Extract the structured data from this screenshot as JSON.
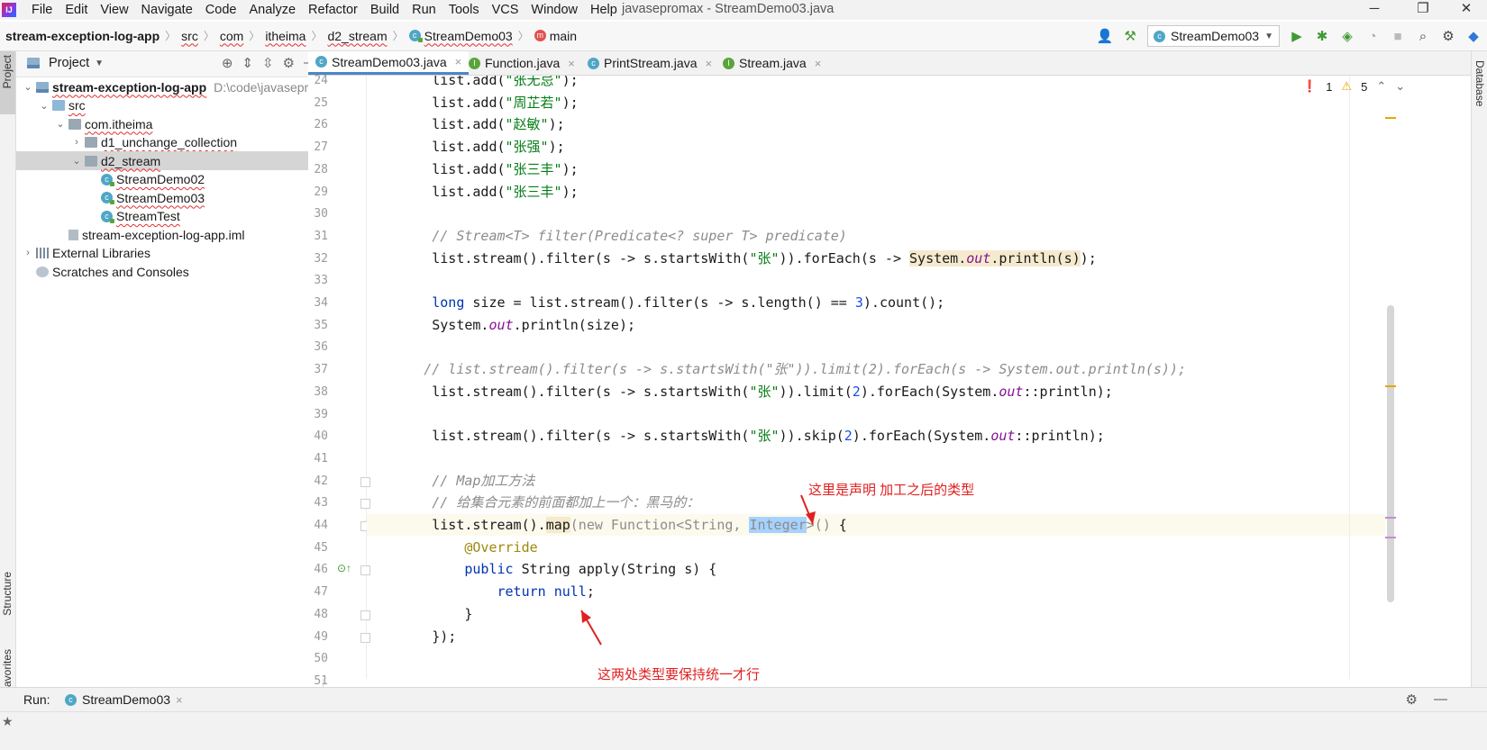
{
  "app": {
    "logo": "IJ",
    "window_title": "javasepromax - StreamDemo03.java",
    "menu": [
      "File",
      "Edit",
      "View",
      "Navigate",
      "Code",
      "Analyze",
      "Refactor",
      "Build",
      "Run",
      "Tools",
      "VCS",
      "Window",
      "Help"
    ],
    "window_buttons": [
      "─",
      "❐",
      "✕"
    ]
  },
  "breadcrumb": {
    "items": [
      "stream-exception-log-app",
      "src",
      "com",
      "itheima",
      "d2_stream",
      "StreamDemo03",
      "main"
    ],
    "run_config": "StreamDemo03"
  },
  "side_strips": {
    "left_top": "Project",
    "left_mid": "Structure",
    "left_bottom": "Favorites",
    "right_top": "Database"
  },
  "project_panel": {
    "title": "Project",
    "tree": [
      {
        "label": "stream-exception-log-app",
        "extra": "D:\\code\\javasepro",
        "indent": 0,
        "icon": "module-folder",
        "arrow": "open",
        "bold": true
      },
      {
        "label": "src",
        "indent": 1,
        "icon": "source-folder",
        "arrow": "open"
      },
      {
        "label": "com.itheima",
        "indent": 2,
        "icon": "package-folder",
        "arrow": "open"
      },
      {
        "label": "d1_unchange_collection",
        "indent": 3,
        "icon": "package-folder",
        "arrow": "closed"
      },
      {
        "label": "d2_stream",
        "indent": 3,
        "icon": "package-folder",
        "arrow": "open",
        "selected": true
      },
      {
        "label": "StreamDemo02",
        "indent": 4,
        "icon": "class"
      },
      {
        "label": "StreamDemo03",
        "indent": 4,
        "icon": "class"
      },
      {
        "label": "StreamTest",
        "indent": 4,
        "icon": "class"
      },
      {
        "label": "stream-exception-log-app.iml",
        "indent": 2,
        "icon": "iml-file"
      },
      {
        "label": "External Libraries",
        "indent": 0,
        "icon": "library",
        "arrow": "closed"
      },
      {
        "label": "Scratches and Consoles",
        "indent": 0,
        "icon": "scratches"
      }
    ]
  },
  "tabs": [
    {
      "label": "StreamDemo03.java",
      "icon": "C",
      "active": true
    },
    {
      "label": "Function.java",
      "icon": "I"
    },
    {
      "label": "PrintStream.java",
      "icon": "C"
    },
    {
      "label": "Stream.java",
      "icon": "I"
    }
  ],
  "inspections": {
    "errors": "1",
    "warnings": "5"
  },
  "code": {
    "line_numbers": [
      "24",
      "25",
      "26",
      "27",
      "28",
      "29",
      "30",
      "31",
      "32",
      "33",
      "34",
      "35",
      "36",
      "37",
      "38",
      "39",
      "40",
      "41",
      "42",
      "43",
      "44",
      "45",
      "46",
      "47",
      "48",
      "49",
      "50",
      "51"
    ],
    "lines": [
      "        list.add(\"张无忌\");",
      "        list.add(\"周芷若\");",
      "        list.add(\"赵敏\");",
      "        list.add(\"张强\");",
      "        list.add(\"张三丰\");",
      "        list.add(\"张三丰\");",
      "",
      "        // Stream<T> filter(Predicate<? super T> predicate)",
      "        list.stream().filter(s -> s.startsWith(\"张\")).forEach(s -> System.out.println(s));",
      "",
      "        long size = list.stream().filter(s -> s.length() == 3).count();",
      "        System.out.println(size);",
      "",
      "       // list.stream().filter(s -> s.startsWith(\"张\")).limit(2).forEach(s -> System.out.println(s));",
      "        list.stream().filter(s -> s.startsWith(\"张\")).limit(2).forEach(System.out::println);",
      "",
      "        list.stream().filter(s -> s.startsWith(\"张\")).skip(2).forEach(System.out::println);",
      "",
      "        // Map加工方法",
      "        // 给集合元素的前面都加上一个：黑马的：",
      "        list.stream().map(new Function<String, Integer>() {",
      "            @Override",
      "            public String apply(String s) {",
      "                return null;",
      "            }",
      "        });",
      "",
      ""
    ]
  },
  "annotations": {
    "top": "这里是声明 加工之后的类型",
    "bottom": "这两处类型要保持统一才行"
  },
  "bottom_bar": {
    "run_label": "Run:",
    "run_tab": "StreamDemo03"
  },
  "colors": {
    "keyword": "#0033b3",
    "string": "#067d17",
    "number": "#1750eb",
    "comment": "#8c8c8c",
    "field": "#871094",
    "annotation": "#9e880d",
    "annotation_text": "#e02020",
    "selection": "#a6d2ff",
    "tab_underline": "#4a88c7"
  }
}
